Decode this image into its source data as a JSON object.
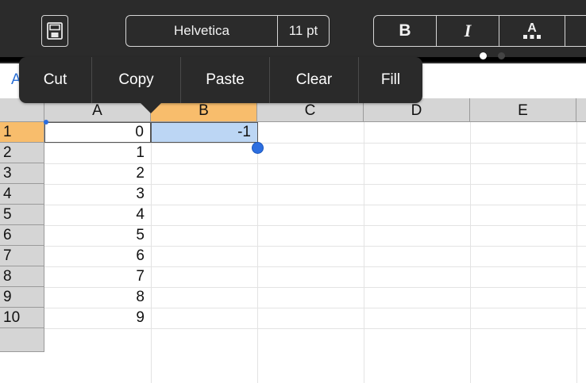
{
  "toolbar": {
    "save_icon": "floppy-disk-icon",
    "font_name": "Helvetica",
    "font_size": "11 pt",
    "bold_label": "B",
    "italic_label": "I",
    "text_color_label": "A",
    "pager": {
      "pages": 2,
      "current": 1
    }
  },
  "formula_bar": {
    "partial_text": "A"
  },
  "context_menu": {
    "items": [
      "Cut",
      "Copy",
      "Paste",
      "Clear",
      "Fill"
    ]
  },
  "sheet": {
    "columns": [
      "A",
      "B",
      "C",
      "D",
      "E"
    ],
    "selected_column": "B",
    "rows": [
      "1",
      "2",
      "3",
      "4",
      "5",
      "6",
      "7",
      "8",
      "9",
      "10"
    ],
    "selected_row": "1",
    "col_a_values": [
      "0",
      "1",
      "2",
      "3",
      "4",
      "5",
      "6",
      "7",
      "8",
      "9"
    ],
    "b1_value": "-1"
  },
  "colors": {
    "toolbar_bg": "#2b2b2b",
    "header_bg": "#d5d5d5",
    "header_selected": "#f8bd6c",
    "selection_fill": "#bcd6f4",
    "handle_blue": "#2c6ee0"
  }
}
